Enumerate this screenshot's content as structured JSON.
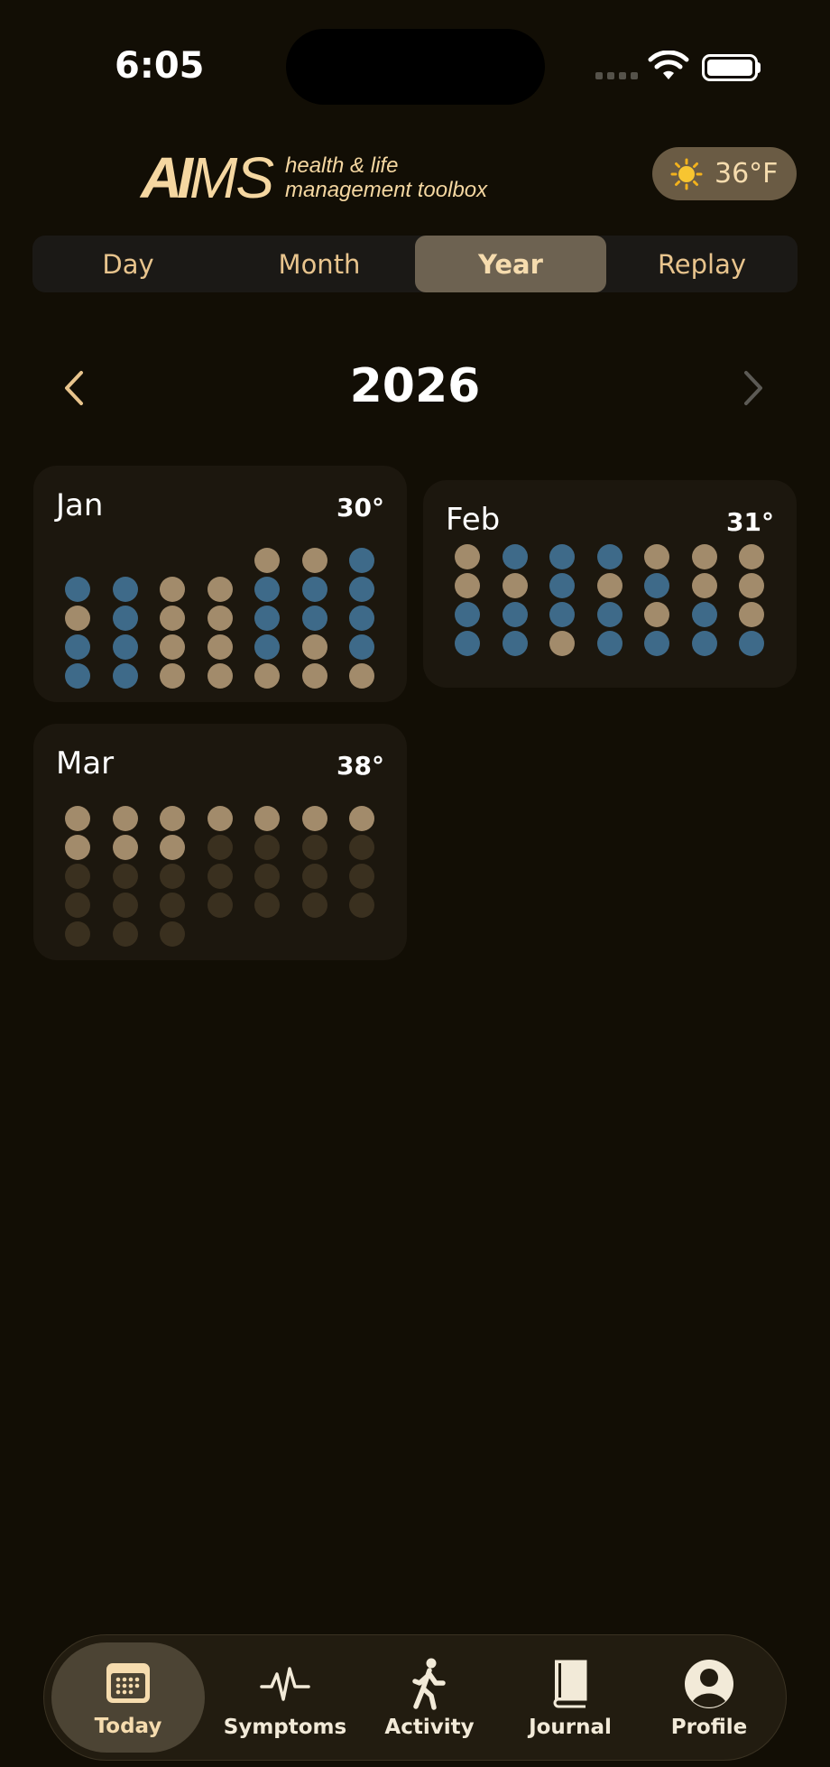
{
  "status": {
    "time": "6:05"
  },
  "header": {
    "logo_ai": "AI",
    "logo_ms": "MS",
    "tagline_1": "health & life",
    "tagline_2": "management toolbox",
    "weather": {
      "icon": "sun-icon",
      "temp": "36°F"
    }
  },
  "segments": [
    {
      "label": "Day",
      "active": false
    },
    {
      "label": "Month",
      "active": false
    },
    {
      "label": "Year",
      "active": true
    },
    {
      "label": "Replay",
      "active": false
    }
  ],
  "year": {
    "title": "2026",
    "prev_icon": "chevron-left-icon",
    "next_icon": "chevron-right-icon"
  },
  "colors": {
    "tan": "#a28b6b",
    "blue": "#3e6a89",
    "empty": "#3a301f",
    "accent": "#f6dcae"
  },
  "months": [
    {
      "name": "Jan",
      "temp": "30°",
      "days": [
        "",
        "",
        "",
        "",
        "t",
        "t",
        "b",
        "b",
        "b",
        "t",
        "t",
        "b",
        "b",
        "b",
        "t",
        "b",
        "t",
        "t",
        "b",
        "b",
        "b",
        "b",
        "b",
        "t",
        "t",
        "b",
        "t",
        "b",
        "b",
        "b",
        "t",
        "t",
        "t",
        "t",
        "t"
      ]
    },
    {
      "name": "Feb",
      "temp": "31°",
      "days": [
        "t",
        "b",
        "b",
        "b",
        "t",
        "t",
        "t",
        "t",
        "t",
        "b",
        "t",
        "b",
        "t",
        "t",
        "b",
        "b",
        "b",
        "b",
        "t",
        "b",
        "t",
        "b",
        "b",
        "t",
        "b",
        "b",
        "b",
        "b"
      ]
    },
    {
      "name": "Mar",
      "temp": "38°",
      "days": [
        "t",
        "t",
        "t",
        "t",
        "t",
        "t",
        "t",
        "t",
        "t",
        "t",
        "d",
        "d",
        "d",
        "d",
        "d",
        "d",
        "d",
        "d",
        "d",
        "d",
        "d",
        "d",
        "d",
        "d",
        "d",
        "d",
        "d",
        "d",
        "d",
        "d",
        "d"
      ]
    }
  ],
  "tabs": [
    {
      "label": "Today",
      "icon": "calendar-icon",
      "active": true
    },
    {
      "label": "Symptoms",
      "icon": "heartbeat-icon",
      "active": false
    },
    {
      "label": "Activity",
      "icon": "walking-icon",
      "active": false
    },
    {
      "label": "Journal",
      "icon": "book-icon",
      "active": false
    },
    {
      "label": "Profile",
      "icon": "person-circle-icon",
      "active": false
    }
  ]
}
